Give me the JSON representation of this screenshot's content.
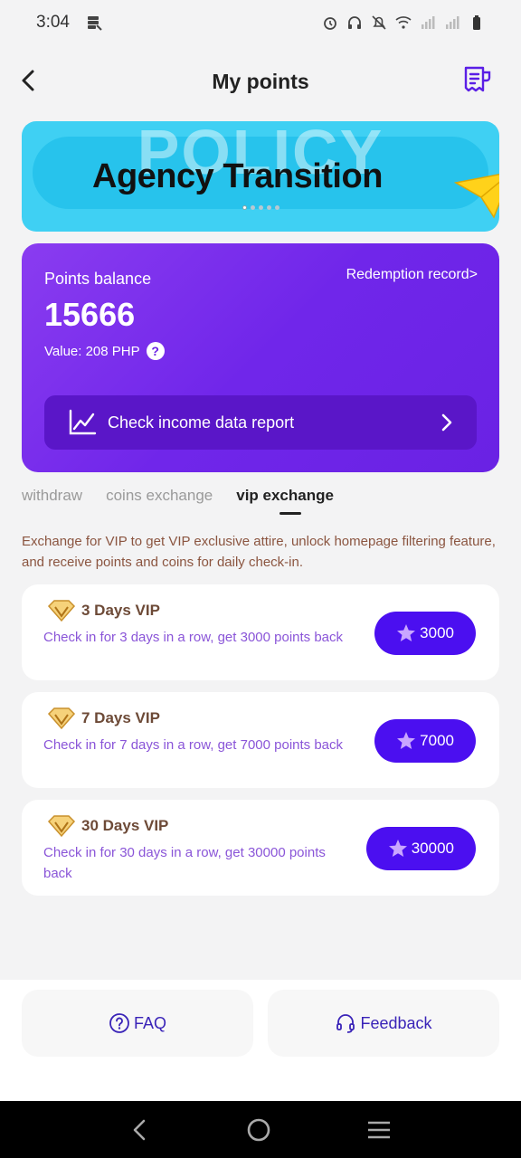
{
  "status_bar": {
    "time": "3:04"
  },
  "header": {
    "title": "My points"
  },
  "banner": {
    "background_word": "POLICY",
    "headline": "Agency Transition",
    "dot_count": 5
  },
  "points_card": {
    "label": "Points balance",
    "balance": "15666",
    "value_text": "Value: 208 PHP",
    "help": "?",
    "record_link": "Redemption record>",
    "report_label": "Check income data report"
  },
  "tabs": [
    {
      "label": "withdraw",
      "active": false
    },
    {
      "label": "coins exchange",
      "active": false
    },
    {
      "label": "vip exchange",
      "active": true
    }
  ],
  "description": "Exchange for VIP to get VIP exclusive attire, unlock homepage filtering feature, and receive points and coins for daily check-in.",
  "vip_items": [
    {
      "title": "3 Days VIP",
      "desc": "Check in for 3 days in a row, get 3000 points back",
      "price": "3000"
    },
    {
      "title": "7 Days VIP",
      "desc": "Check in for 7 days in a row, get 7000 points back",
      "price": "7000"
    },
    {
      "title": "30 Days VIP",
      "desc": "Check in for 30 days in a row, get 30000 points back",
      "price": "30000"
    }
  ],
  "bottom": {
    "faq": "FAQ",
    "feedback": "Feedback"
  },
  "colors": {
    "accent": "#4b0ff0",
    "card_purple": "#7026ea",
    "banner_blue": "#3fd0f3",
    "vip_title": "#6d4a37",
    "vip_desc": "#8a55d8"
  },
  "icons": [
    "storage-icon",
    "alarm-icon",
    "headphones-icon",
    "bell-off-icon",
    "wifi-icon",
    "signal-icon",
    "battery-icon",
    "back-arrow-icon",
    "receipt-icon",
    "chart-icon",
    "chevron-right-icon",
    "diamond-icon",
    "star-icon",
    "question-circle-icon",
    "headset-icon"
  ]
}
